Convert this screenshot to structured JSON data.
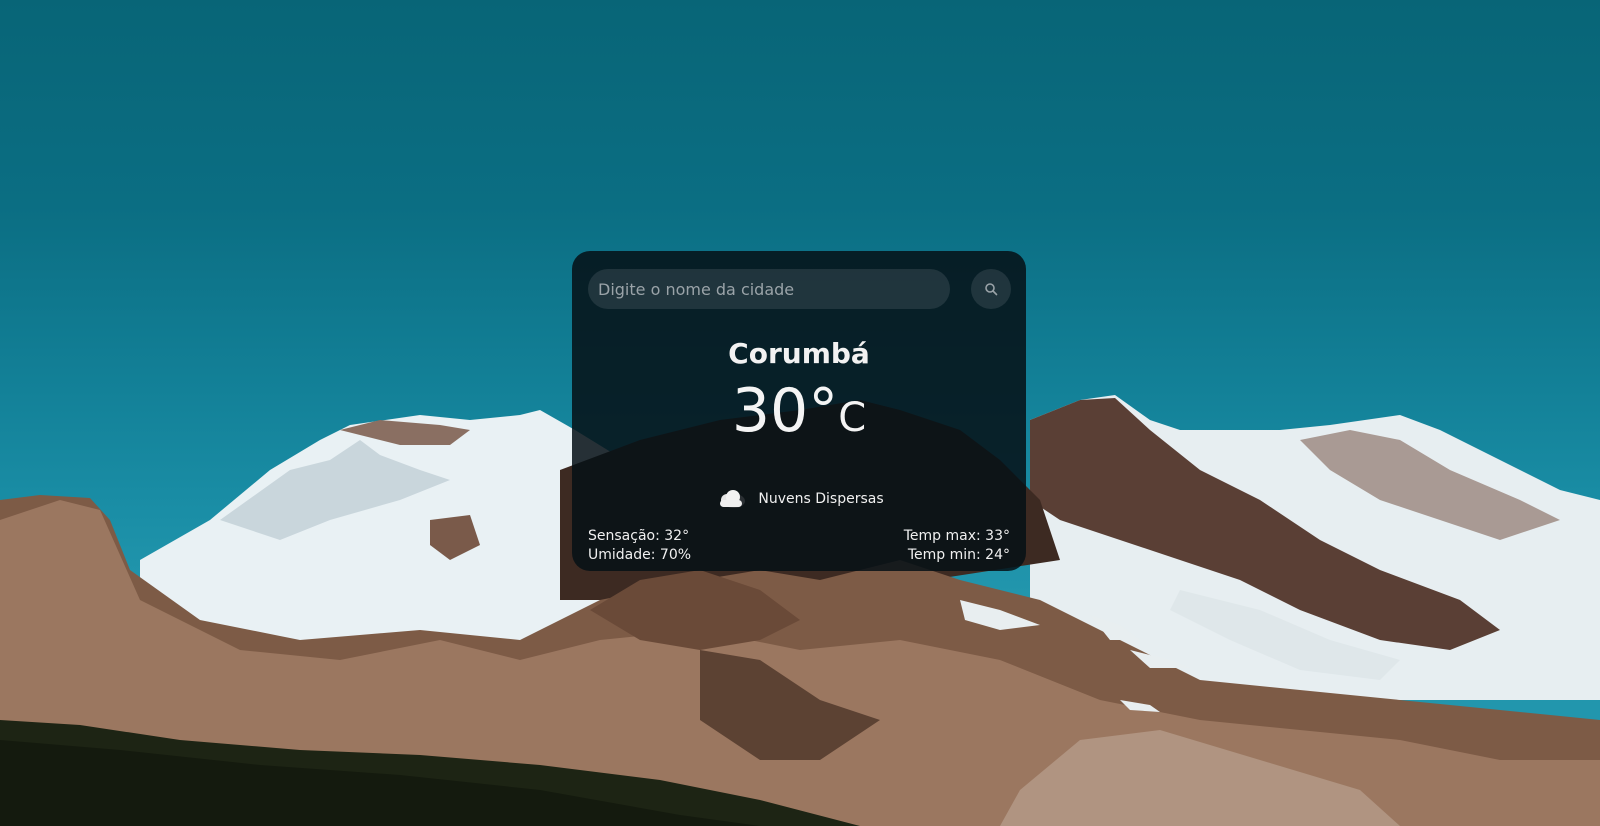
{
  "search": {
    "placeholder": "Digite o nome da cidade",
    "value": ""
  },
  "weather": {
    "city": "Corumbá",
    "temperature": "30°",
    "unit": "C",
    "condition": "Nuvens Dispersas",
    "condition_icon": "cloud-icon",
    "feels_like_label": "Sensação:",
    "feels_like": "32°",
    "humidity_label": "Umidade:",
    "humidity": "70%",
    "temp_max_label": "Temp max:",
    "temp_max": "33°",
    "temp_min_label": "Temp min:",
    "temp_min": "24°"
  },
  "icons": {
    "search": "search-icon",
    "cloud": "cloud-icon"
  },
  "colors": {
    "card_background": "#061016",
    "text": "#ffffff",
    "sky_top": "#086577",
    "sky_bottom": "#2296ad"
  }
}
